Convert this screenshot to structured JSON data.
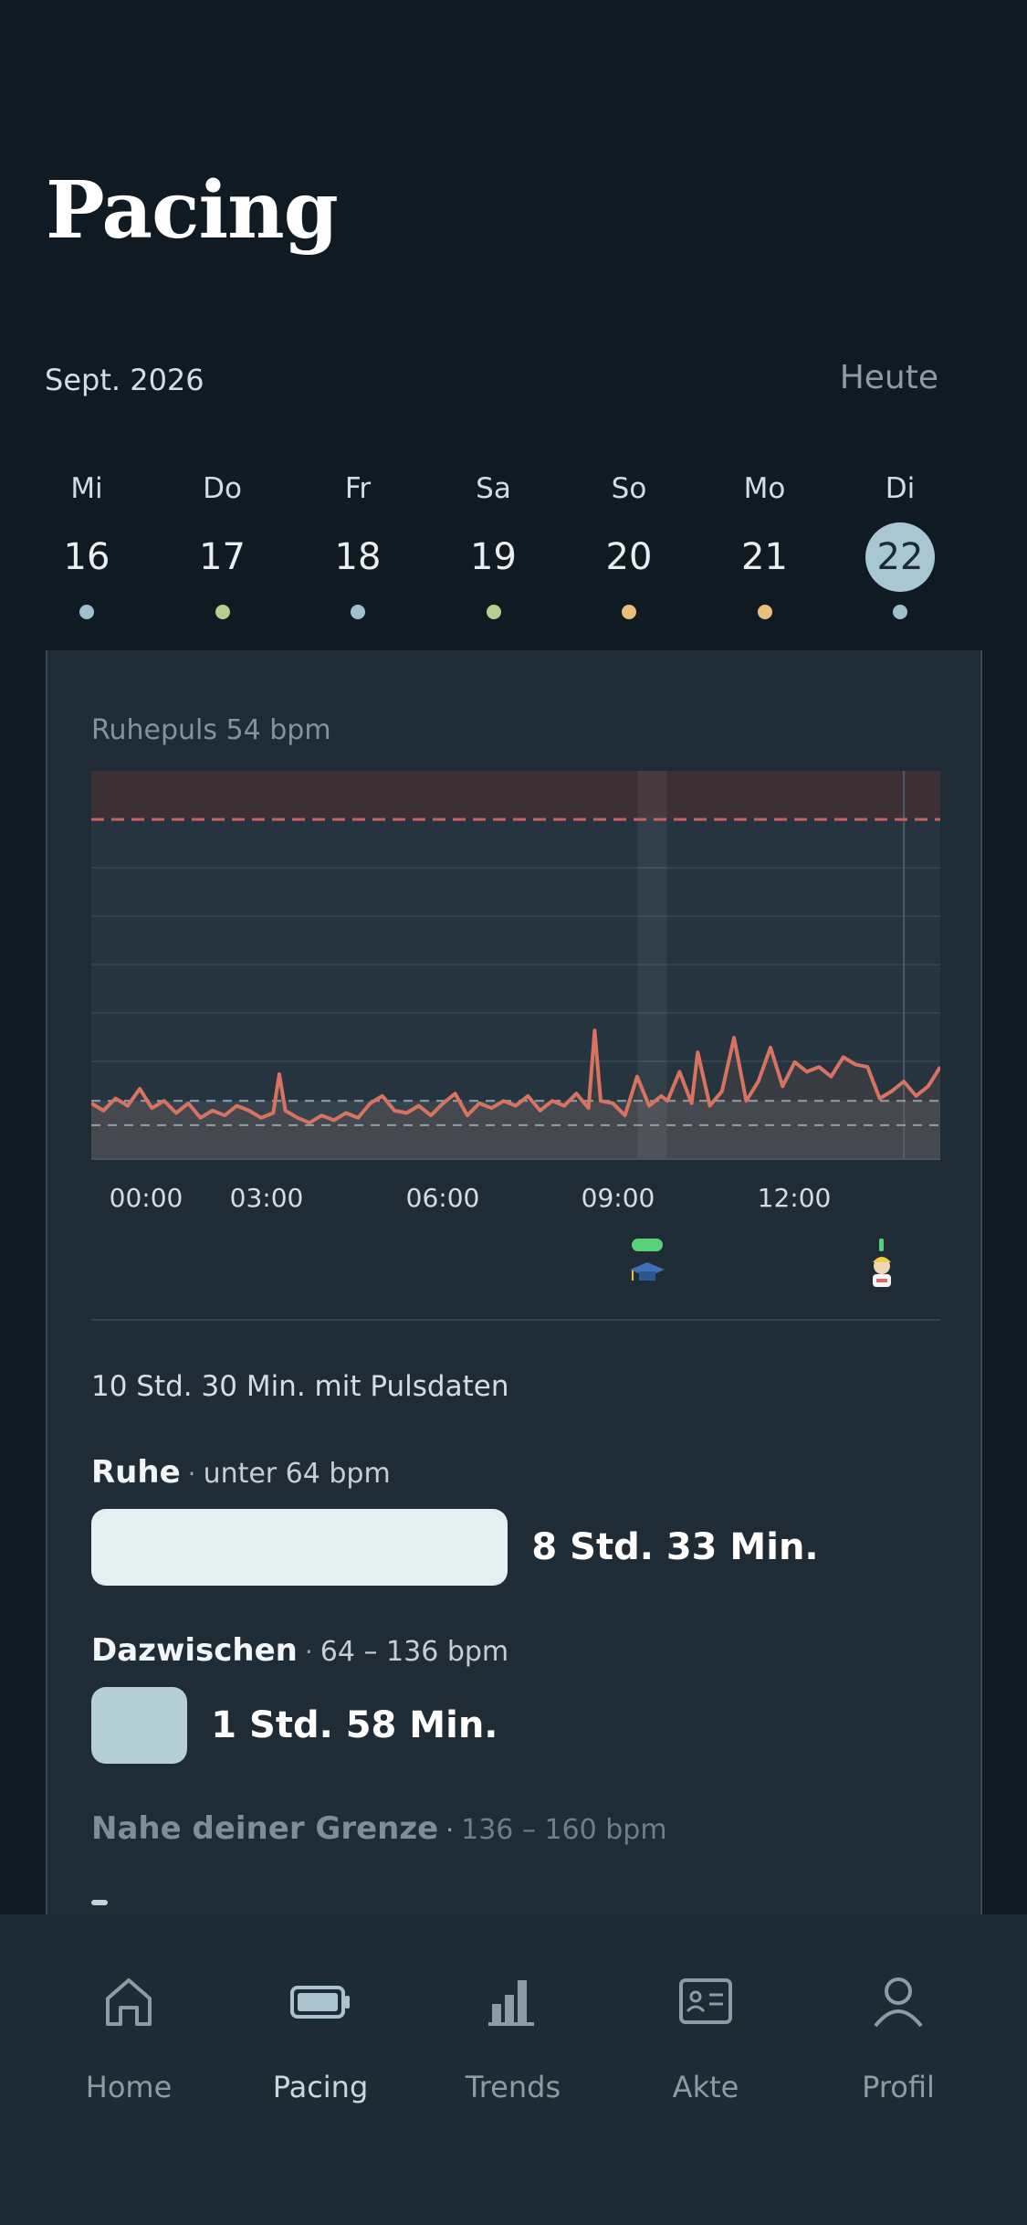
{
  "header": {
    "title": "Pacing"
  },
  "calendar": {
    "month": "Sept. 2026",
    "today_label": "Heute",
    "days": [
      {
        "name": "Mi",
        "num": "16",
        "dot": "#9fc0cc"
      },
      {
        "name": "Do",
        "num": "17",
        "dot": "#b7cc8e"
      },
      {
        "name": "Fr",
        "num": "18",
        "dot": "#9fc0cc"
      },
      {
        "name": "Sa",
        "num": "19",
        "dot": "#b7cc8e"
      },
      {
        "name": "So",
        "num": "20",
        "dot": "#e8c07c"
      },
      {
        "name": "Mo",
        "num": "21",
        "dot": "#e8c07c"
      },
      {
        "name": "Di",
        "num": "22",
        "dot": "#9fc0cc",
        "selected": true
      }
    ]
  },
  "heart": {
    "resting_label": "Ruhepuls 54 bpm",
    "duration_summary": "10 Std. 30 Min. mit Pulsdaten"
  },
  "chart_data": {
    "type": "line",
    "x_unit": "hour",
    "xticks": [
      "00:00",
      "03:00",
      "06:00",
      "09:00",
      "12:00"
    ],
    "xlim": [
      0,
      14
    ],
    "ylim": [
      40,
      200
    ],
    "limit_line": 180,
    "resting_band": [
      54,
      64
    ],
    "highlight_hour": 9.25,
    "marker_hour": 13.4,
    "series": [
      {
        "x": [
          0,
          0.2,
          0.4,
          0.6,
          0.8,
          1.0,
          1.2,
          1.4,
          1.6,
          1.8,
          2.0,
          2.2,
          2.4,
          2.6,
          2.8,
          3.0,
          3.1,
          3.2,
          3.4,
          3.6,
          3.8,
          4.0,
          4.2,
          4.4,
          4.6,
          4.8,
          5.0,
          5.2,
          5.4,
          5.6,
          5.8,
          6.0,
          6.2,
          6.4,
          6.6,
          6.8,
          7.0,
          7.2,
          7.4,
          7.6,
          7.8,
          8.0,
          8.2,
          8.3,
          8.4,
          8.6,
          8.8,
          9.0,
          9.2,
          9.4,
          9.5,
          9.7,
          9.9,
          10.0,
          10.2,
          10.4,
          10.6,
          10.8,
          11.0,
          11.2,
          11.4,
          11.6,
          11.8,
          12.0,
          12.2,
          12.4,
          12.6,
          12.8,
          13.0,
          13.2,
          13.4,
          13.6,
          13.8,
          14.0
        ],
        "y": [
          63,
          60,
          65,
          62,
          69,
          61,
          64,
          59,
          63,
          57,
          60,
          58,
          62,
          60,
          57,
          59,
          75,
          60,
          57,
          55,
          58,
          56,
          59,
          57,
          63,
          66,
          60,
          59,
          62,
          58,
          63,
          67,
          58,
          63,
          61,
          64,
          62,
          66,
          60,
          64,
          62,
          67,
          61,
          93,
          64,
          63,
          58,
          74,
          62,
          66,
          64,
          76,
          63,
          84,
          62,
          68,
          90,
          64,
          72,
          86,
          70,
          80,
          76,
          78,
          74,
          82,
          79,
          78,
          65,
          68,
          72,
          66,
          70,
          78
        ]
      }
    ]
  },
  "zones": [
    {
      "name": "Ruhe",
      "range": "unter 64 bpm",
      "value": "8 Std. 33 Min.",
      "fraction": 0.815,
      "color": "#e4eff0"
    },
    {
      "name": "Dazwischen",
      "range": "64 – 136 bpm",
      "value": "1 Std. 58 Min.",
      "fraction": 0.188,
      "color": "#b6cfd6"
    },
    {
      "name": "Nahe deiner Grenze",
      "range": "136 – 160 bpm",
      "value": "",
      "fraction": 0.01,
      "color": "#c5d3d8"
    }
  ],
  "tabs": [
    {
      "label": "Home",
      "icon": "home-icon"
    },
    {
      "label": "Pacing",
      "icon": "battery-icon",
      "active": true
    },
    {
      "label": "Trends",
      "icon": "bar-chart-icon"
    },
    {
      "label": "Akte",
      "icon": "id-card-icon"
    },
    {
      "label": "Profil",
      "icon": "person-icon"
    }
  ]
}
